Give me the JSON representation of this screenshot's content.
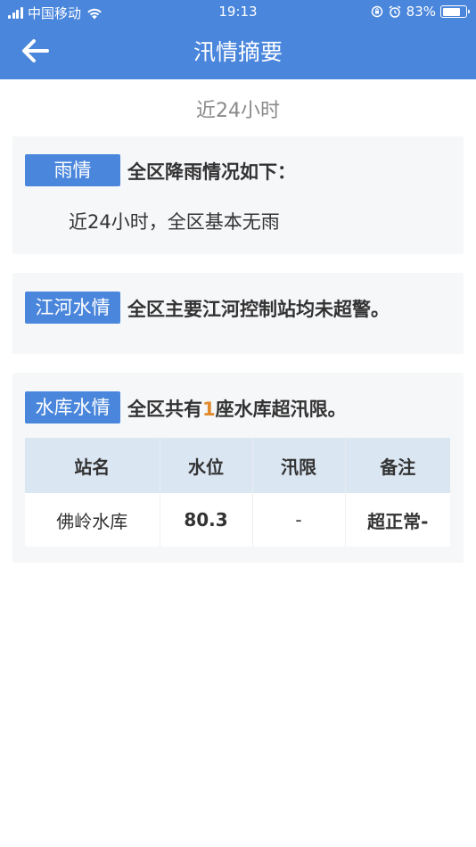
{
  "status_bar": {
    "carrier": "中国移动",
    "time": "19:13",
    "battery": "83%",
    "battery_level": 0.83,
    "icons": [
      "signal-icon",
      "wifi-icon",
      "screen-lock-icon",
      "alarm-icon",
      "battery-icon"
    ]
  },
  "header": {
    "title": "汛情摘要",
    "back_icon": "arrow-left-icon",
    "bg_color": "#4a86dc"
  },
  "period": "近24小时",
  "rain": {
    "tag": "雨情",
    "headline": "全区降雨情况如下：",
    "detail": "近24小时，全区基本无雨"
  },
  "river": {
    "tag": "江河水情",
    "headline": "全区主要江河控制站均未超警。"
  },
  "reservoir": {
    "tag": "水库水情",
    "headline_pre": "全区共有",
    "headline_count": "1",
    "headline_post": "座水库超汛限。",
    "table": {
      "headers": [
        "站名",
        "水位",
        "汛限",
        "备注"
      ],
      "rows": [
        [
          "佛岭水库",
          "80.3",
          "-",
          "超正常-"
        ]
      ]
    }
  },
  "colors": {
    "accent": "#4a86dc",
    "warning": "#e08a2b"
  }
}
